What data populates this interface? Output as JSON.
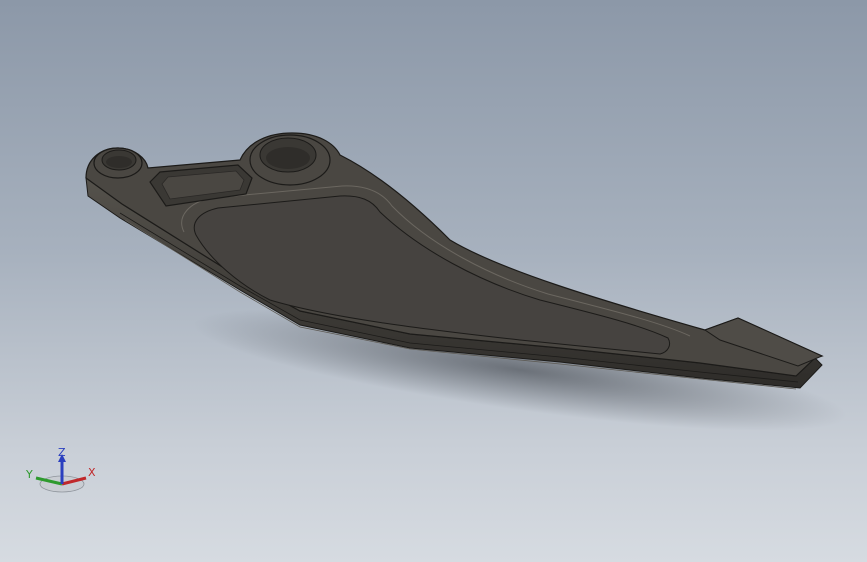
{
  "viewport": {
    "background_top": "#8c98a8",
    "background_bottom": "#d6dbe1"
  },
  "model": {
    "part": "bracket-arm",
    "body_color": "#3f3d39",
    "face_color": "#4a4742",
    "edge_color": "#1c1b19",
    "highlight_color": "#6b6760"
  },
  "triad": {
    "x_label": "X",
    "y_label": "Y",
    "z_label": "Z",
    "x_color": "#c0282a",
    "y_color": "#2e9a2e",
    "z_color": "#2a3fbf"
  }
}
